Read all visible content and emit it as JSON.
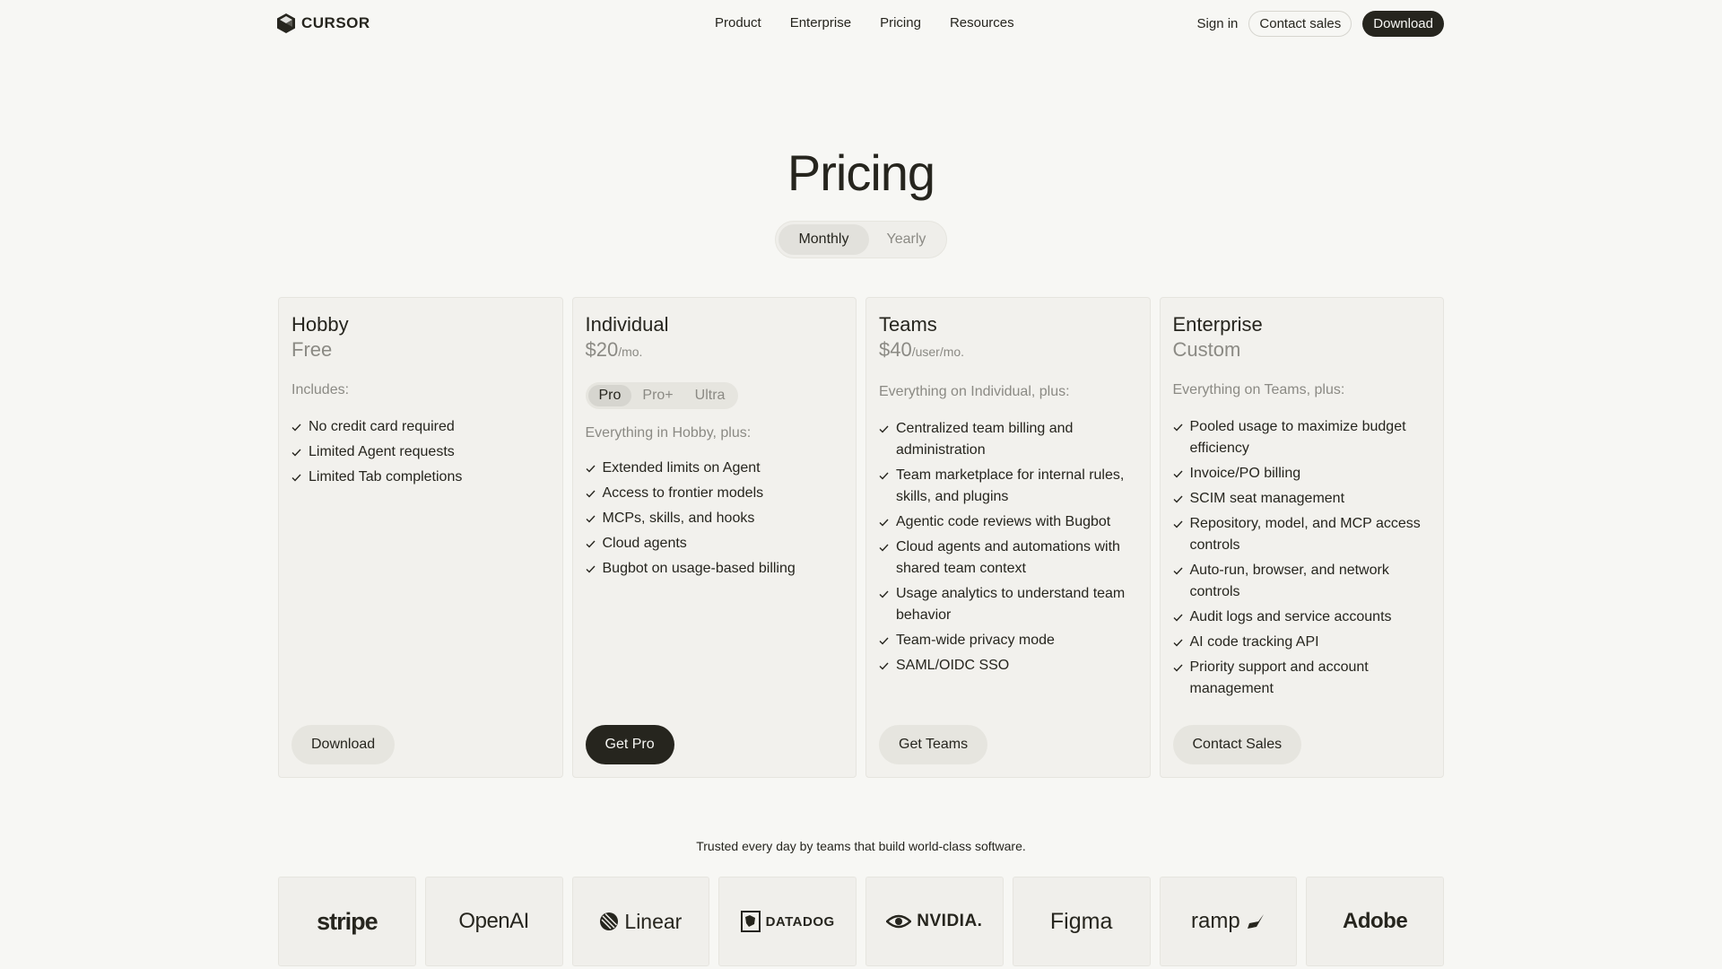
{
  "brand": {
    "name": "CURSOR",
    "logo_icon": "cube-logo-icon"
  },
  "nav": {
    "links": [
      "Product",
      "Enterprise",
      "Pricing",
      "Resources"
    ],
    "signin": "Sign in",
    "contact": "Contact sales",
    "download": "Download"
  },
  "hero": {
    "title": "Pricing"
  },
  "billing_toggle": {
    "options": [
      "Monthly",
      "Yearly"
    ],
    "selected": "Monthly"
  },
  "plans": [
    {
      "name": "Hobby",
      "price": "Free",
      "unit": "",
      "includes": "Includes:",
      "features": [
        "No credit card required",
        "Limited Agent requests",
        "Limited Tab completions"
      ],
      "button": "Download"
    },
    {
      "name": "Individual",
      "price": "$20",
      "unit": "/mo.",
      "tiers": [
        "Pro",
        "Pro+",
        "Ultra"
      ],
      "selected_tier": "Pro",
      "includes": "Everything in Hobby, plus:",
      "features": [
        "Extended limits on Agent",
        "Access to frontier models",
        "MCPs, skills, and hooks",
        "Cloud agents",
        "Bugbot on usage-based billing"
      ],
      "button": "Get Pro"
    },
    {
      "name": "Teams",
      "price": "$40",
      "unit": "/user/mo.",
      "includes": "Everything on Individual, plus:",
      "features": [
        "Centralized team billing and administration",
        "Team marketplace for internal rules, skills, and plugins",
        "Agentic code reviews with Bugbot",
        "Cloud agents and automations with shared team context",
        "Usage analytics to understand team behavior",
        "Team-wide privacy mode",
        "SAML/OIDC SSO"
      ],
      "button": "Get Teams"
    },
    {
      "name": "Enterprise",
      "price": "Custom",
      "unit": "",
      "includes": "Everything on Teams, plus:",
      "features": [
        "Pooled usage to maximize budget efficiency",
        "Invoice/PO billing",
        "SCIM seat management",
        "Repository, model, and MCP access controls",
        "Auto-run, browser, and network controls",
        "Audit logs and service accounts",
        "AI code tracking API",
        "Priority support and account management"
      ],
      "button": "Contact Sales"
    }
  ],
  "trusted": {
    "text": "Trusted every day by teams that build world-class software.",
    "logos": [
      "stripe",
      "OpenAI",
      "Linear",
      "DATADOG",
      "NVIDIA.",
      "Figma",
      "ramp",
      "Adobe"
    ]
  },
  "colors": {
    "ink": "#26251e",
    "background": "#f7f7f4",
    "muted": "#8b8a84",
    "card": "#f2f1ed"
  }
}
